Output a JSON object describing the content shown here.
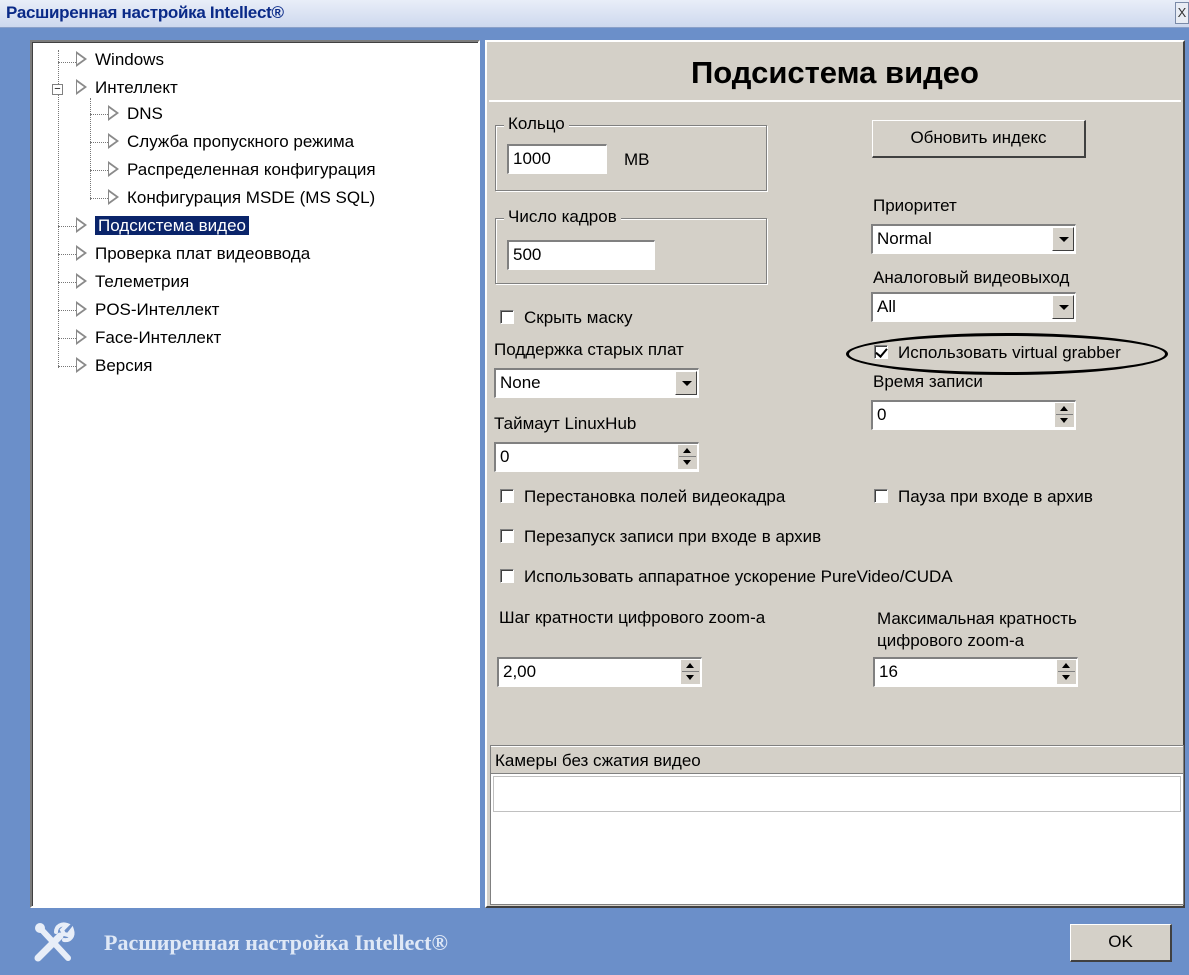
{
  "window": {
    "title": "Расширенная настройка Intellect®",
    "close_label": "X"
  },
  "tree": {
    "items": [
      {
        "label": "Windows"
      },
      {
        "label": "Интеллект"
      },
      {
        "label": "DNS"
      },
      {
        "label": "Служба пропускного режима"
      },
      {
        "label": "Распределенная конфигурация"
      },
      {
        "label": "Конфигурация MSDE (MS SQL)"
      },
      {
        "label": "Подсистема видео",
        "selected": true
      },
      {
        "label": "Проверка плат видеоввода"
      },
      {
        "label": "Телеметрия"
      },
      {
        "label": "POS-Интеллект"
      },
      {
        "label": "Face-Интеллект"
      },
      {
        "label": "Версия"
      }
    ],
    "expander_label": "−"
  },
  "panel": {
    "title": "Подсистема видео",
    "ring": {
      "group_label": "Кольцо",
      "value": "1000",
      "unit": "MB"
    },
    "frames": {
      "group_label": "Число кадров",
      "value": "500"
    },
    "update_index_button": "Обновить индекс",
    "priority": {
      "label": "Приоритет",
      "value": "Normal"
    },
    "analog_out": {
      "label": "Аналоговый видеовыход",
      "value": "All"
    },
    "hide_mask": {
      "label": "Скрыть маску",
      "checked": false
    },
    "legacy_boards": {
      "label": "Поддержка старых плат",
      "value": "None"
    },
    "virtual_grabber": {
      "label": "Использовать virtual grabber",
      "checked": true
    },
    "record_time": {
      "label": "Время записи",
      "value": "0"
    },
    "linuxhub_timeout": {
      "label": "Таймаут LinuxHub",
      "value": "0"
    },
    "field_swap": {
      "label": "Перестановка полей видеокадра",
      "checked": false
    },
    "pause_archive": {
      "label": "Пауза при входе в архив",
      "checked": false
    },
    "restart_record": {
      "label": "Перезапуск записи при входе в архив",
      "checked": false
    },
    "hw_accel": {
      "label": "Использовать аппаратное ускорение PureVideo/CUDA",
      "checked": false
    },
    "zoom_step": {
      "label": "Шаг кратности цифрового zoom-a",
      "value": "2,00"
    },
    "zoom_max": {
      "label_line1": "Максимальная кратность",
      "label_line2": "цифрового zoom-a",
      "value": "16"
    },
    "uncompressed_cameras": {
      "header": "Камеры без сжатия видео"
    }
  },
  "footer": {
    "text": "Расширенная настройка Intellect®",
    "ok_button": "OK"
  }
}
